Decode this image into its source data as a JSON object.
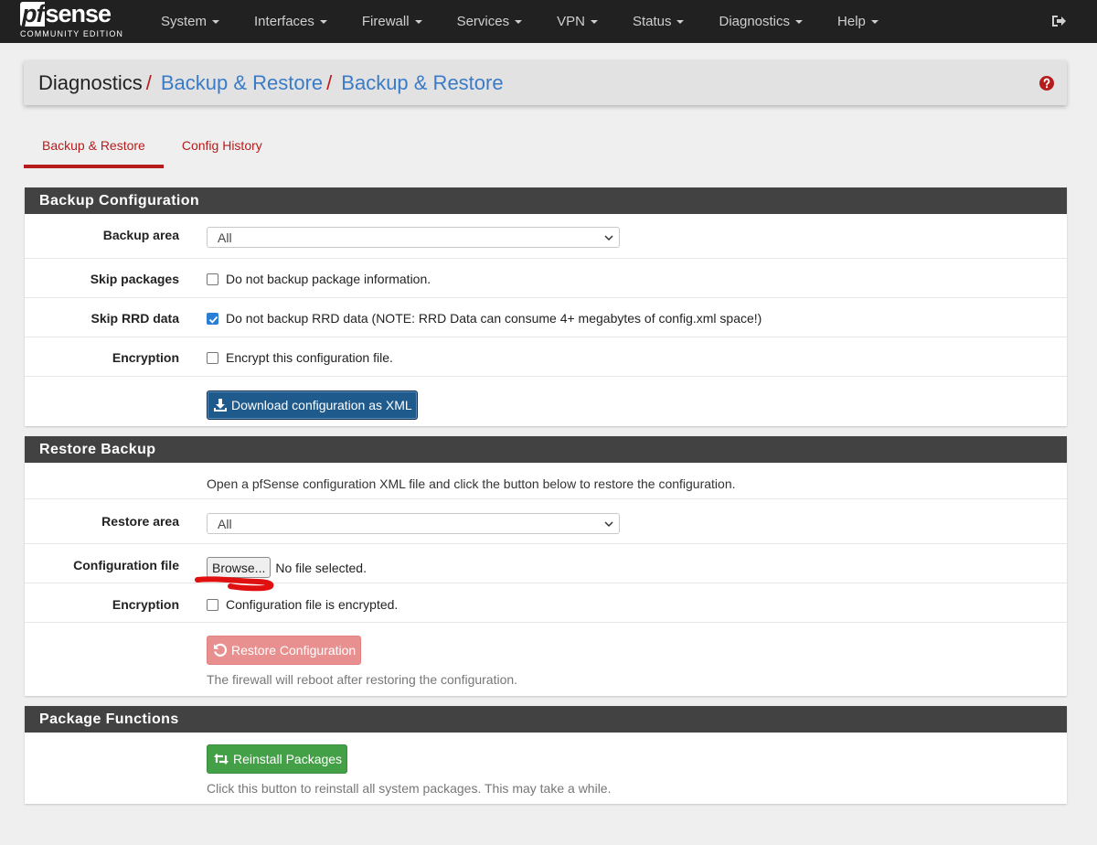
{
  "brand": {
    "logo_pf": "pf",
    "logo_sense": "sense",
    "subtitle": "COMMUNITY EDITION"
  },
  "nav": {
    "items": [
      {
        "label": "System"
      },
      {
        "label": "Interfaces"
      },
      {
        "label": "Firewall"
      },
      {
        "label": "Services"
      },
      {
        "label": "VPN"
      },
      {
        "label": "Status"
      },
      {
        "label": "Diagnostics"
      },
      {
        "label": "Help"
      }
    ],
    "logout_icon": "sign-out-icon"
  },
  "breadcrumb": {
    "root": "Diagnostics",
    "sep": "/",
    "level1": "Backup & Restore",
    "level2": "Backup & Restore",
    "help_icon": "question-circle-icon"
  },
  "tabs": [
    {
      "label": "Backup & Restore",
      "active": true
    },
    {
      "label": "Config History",
      "active": false
    }
  ],
  "backup": {
    "title": "Backup Configuration",
    "area_label": "Backup area",
    "area_value": "All",
    "skip_packages_label": "Skip packages",
    "skip_packages_text": "Do not backup package information.",
    "skip_packages_checked": false,
    "skip_rrd_label": "Skip RRD data",
    "skip_rrd_text": "Do not backup RRD data (NOTE: RRD Data can consume 4+ megabytes of config.xml space!)",
    "skip_rrd_checked": true,
    "encryption_label": "Encryption",
    "encryption_text": "Encrypt this configuration file.",
    "encryption_checked": false,
    "download_button": "Download configuration as XML"
  },
  "restore": {
    "title": "Restore Backup",
    "intro": "Open a pfSense configuration XML file and click the button below to restore the configuration.",
    "area_label": "Restore area",
    "area_value": "All",
    "file_label": "Configuration file",
    "browse_button": "Browse...",
    "file_status": "No file selected.",
    "encryption_label": "Encryption",
    "encryption_text": "Configuration file is encrypted.",
    "encryption_checked": false,
    "restore_button": "Restore Configuration",
    "restore_help": "The firewall will reboot after restoring the configuration."
  },
  "packages": {
    "title": "Package Functions",
    "reinstall_button": "Reinstall Packages",
    "reinstall_help": "Click this button to reinstall all system packages. This may take a while."
  },
  "colors": {
    "navbar": "#212121",
    "accent_red": "#b71c1c",
    "link_blue": "#3a7bc8",
    "primary": "#1e5a8c",
    "danger": "#e88f8f",
    "success": "#43a047",
    "annotation_red": "#e01010"
  }
}
